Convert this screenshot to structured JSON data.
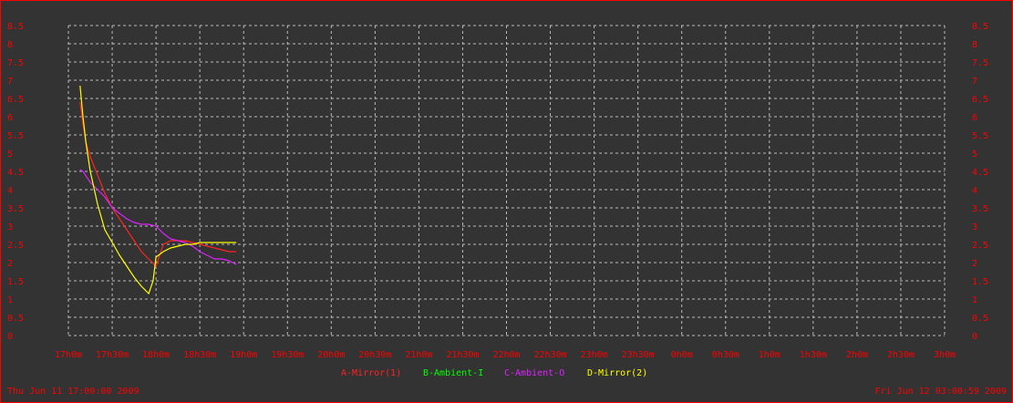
{
  "colors": {
    "background": "#333333",
    "border": "#ff0000",
    "grid": "#bbbbbb",
    "tick_label": "#ff0000",
    "stamp": "#ff0000"
  },
  "stamps": {
    "start": "Thu Jun 11 17:00:00 2009",
    "end": "Fri Jun 12 03:00:59 2009"
  },
  "chart_data": {
    "type": "line",
    "title": "",
    "xlabel": "",
    "ylabel": "",
    "grid": true,
    "legend_position": "bottom-center",
    "ylim": [
      0,
      8.5
    ],
    "y_ticks": [
      "0",
      "0.5",
      "1",
      "1.5",
      "2",
      "2.5",
      "3",
      "3.5",
      "4",
      "4.5",
      "5",
      "5.5",
      "6",
      "6.5",
      "7",
      "7.5",
      "8",
      "8.5"
    ],
    "x_ticks": [
      "17h0m",
      "17h30m",
      "18h0m",
      "18h30m",
      "19h0m",
      "19h30m",
      "20h0m",
      "20h30m",
      "21h0m",
      "21h30m",
      "22h0m",
      "22h30m",
      "23h0m",
      "23h30m",
      "0h0m",
      "0h30m",
      "1h0m",
      "1h30m",
      "2h0m",
      "2h30m",
      "3h0m"
    ],
    "series": [
      {
        "name": "A-Mirror(1)",
        "color": "#ff2222",
        "x": [
          "17h08m",
          "17h10m",
          "17h12m",
          "17h15m",
          "17h20m",
          "17h25m",
          "17h30m",
          "17h35m",
          "17h40m",
          "17h45m",
          "17h50m",
          "17h55m",
          "18h00m",
          "18h05m",
          "18h10m",
          "18h15m",
          "18h20m",
          "18h25m",
          "18h30m",
          "18h35m",
          "18h40m",
          "18h45m",
          "18h50m",
          "18h55m"
        ],
        "values": [
          6.4,
          5.8,
          5.3,
          4.9,
          4.4,
          3.9,
          3.5,
          3.2,
          2.9,
          2.6,
          2.3,
          2.1,
          1.9,
          2.5,
          2.6,
          2.6,
          2.6,
          2.55,
          2.5,
          2.45,
          2.4,
          2.35,
          2.3,
          2.3
        ]
      },
      {
        "name": "B-Ambient-I",
        "color": "#00ff00",
        "x": [],
        "values": []
      },
      {
        "name": "C-Ambient-O",
        "color": "#dd22ff",
        "x": [
          "17h08m",
          "17h10m",
          "17h15m",
          "17h20m",
          "17h25m",
          "17h30m",
          "17h35m",
          "17h40m",
          "17h45m",
          "17h50m",
          "17h55m",
          "18h00m",
          "18h05m",
          "18h10m",
          "18h15m",
          "18h20m",
          "18h25m",
          "18h30m",
          "18h35m",
          "18h40m",
          "18h45m",
          "18h50m",
          "18h55m"
        ],
        "values": [
          4.55,
          4.5,
          4.2,
          4.0,
          3.8,
          3.5,
          3.35,
          3.2,
          3.1,
          3.05,
          3.05,
          3.0,
          2.8,
          2.65,
          2.6,
          2.55,
          2.45,
          2.3,
          2.2,
          2.1,
          2.1,
          2.05,
          1.95
        ]
      },
      {
        "name": "D-Mirror(2)",
        "color": "#ffff00",
        "x": [
          "17h08m",
          "17h10m",
          "17h12m",
          "17h15m",
          "17h20m",
          "17h25m",
          "17h30m",
          "17h35m",
          "17h40m",
          "17h45m",
          "17h50m",
          "17h55m",
          "17h58m",
          "18h00m",
          "18h05m",
          "18h10m",
          "18h15m",
          "18h20m",
          "18h25m",
          "18h30m",
          "18h40m",
          "18h50m",
          "18h55m"
        ],
        "values": [
          6.85,
          6.0,
          5.3,
          4.5,
          3.6,
          2.9,
          2.55,
          2.2,
          1.9,
          1.6,
          1.35,
          1.15,
          1.5,
          2.15,
          2.3,
          2.4,
          2.45,
          2.5,
          2.5,
          2.55,
          2.55,
          2.55,
          2.55
        ]
      }
    ]
  }
}
